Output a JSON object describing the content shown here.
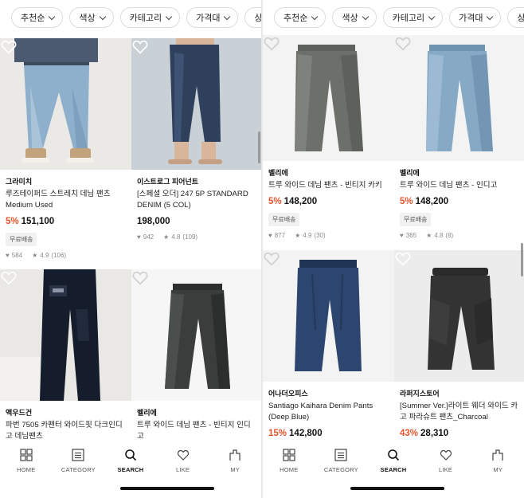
{
  "filters": [
    "추천순",
    "색상",
    "카테고리",
    "가격대",
    "상품정보"
  ],
  "left": {
    "products": [
      {
        "brand": "그라미치",
        "name": "루즈테이퍼드 스트레치 데님 팬츠 Medium Used",
        "discount": "5%",
        "price": "151,100",
        "badge": "무료배송",
        "likes": "584",
        "rating": "4.9",
        "reviews": "(106)"
      },
      {
        "brand": "이스트로그 피어넌트",
        "name": "[스페셜 오더] 247 5P STANDARD DENIM (5 COL)",
        "discount": "",
        "price": "198,000",
        "badge": "",
        "likes": "942",
        "rating": "4.8",
        "reviews": "(109)"
      },
      {
        "brand": "액우드건",
        "name": "파번 7505 카펜터 와이드핏 다크인디고 데님팬츠",
        "discount": "",
        "price": "",
        "badge": "",
        "likes": "",
        "rating": "",
        "reviews": ""
      },
      {
        "brand": "벨리에",
        "name": "트루 와이드 데님 팬츠 - 빈티지 인디고",
        "discount": "",
        "price": "",
        "badge": "",
        "likes": "",
        "rating": "",
        "reviews": ""
      }
    ]
  },
  "right": {
    "products": [
      {
        "brand": "벨리에",
        "name": "트루 와이드 데님 팬츠 - 빈티지 카키",
        "discount": "5%",
        "price": "148,200",
        "badge": "무료배송",
        "likes": "877",
        "rating": "4.9",
        "reviews": "(30)"
      },
      {
        "brand": "벨리에",
        "name": "트루 와이드 데님 팬츠 - 인디고",
        "discount": "5%",
        "price": "148,200",
        "badge": "무료배송",
        "likes": "365",
        "rating": "4.8",
        "reviews": "(8)"
      },
      {
        "brand": "어나더오피스",
        "name": "Santiago Kaihara Denim Pants (Deep Blue)",
        "discount": "15%",
        "price": "142,800",
        "badge": "",
        "likes": "",
        "rating": "",
        "reviews": ""
      },
      {
        "brand": "라퍼지스토어",
        "name": "[Summer Ver.]라이트 웨더 와이드 카고 파라슈트 팬츠_Charcoal",
        "discount": "43%",
        "price": "28,310",
        "badge": "",
        "likes": "",
        "rating": "",
        "reviews": ""
      }
    ]
  },
  "nav": [
    {
      "label": "HOME",
      "icon": "grid-icon"
    },
    {
      "label": "CATEGORY",
      "icon": "list-icon"
    },
    {
      "label": "SEARCH",
      "icon": "search-icon",
      "active": true
    },
    {
      "label": "LIKE",
      "icon": "heart-icon"
    },
    {
      "label": "MY",
      "icon": "person-icon"
    }
  ],
  "colors": {
    "discount": "#e4562c",
    "muted": "#8a8a8a",
    "badge_bg": "#f1f1f1"
  }
}
